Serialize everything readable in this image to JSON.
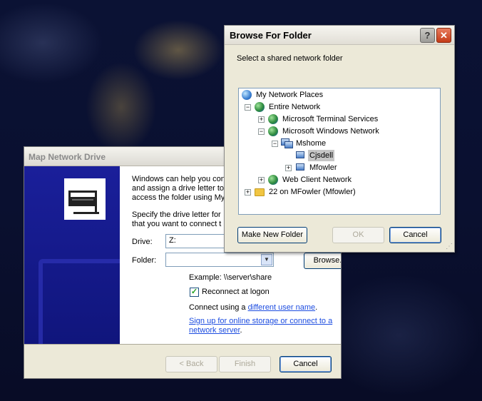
{
  "map_network_drive": {
    "title": "Map Network Drive",
    "intro_lines": [
      "Windows can help you conn",
      "and assign a drive letter to",
      "access the folder using My"
    ],
    "specify_lines": [
      "Specify the drive letter for",
      "that you want to connect t"
    ],
    "drive_label": "Drive:",
    "drive_value": "Z:",
    "folder_label": "Folder:",
    "folder_value": "",
    "browse_label": "Browse...",
    "example_text": "Example: \\\\server\\share",
    "reconnect_label": "Reconnect at logon",
    "reconnect_checked": true,
    "connect_prefix": "Connect using a ",
    "connect_link": "different user name",
    "connect_suffix": ".",
    "signup_line1": "Sign up for online storage or connect to a",
    "signup_line2": "network server",
    "signup_suffix": ".",
    "back_label": "< Back",
    "finish_label": "Finish",
    "cancel_label": "Cancel"
  },
  "browse_for_folder": {
    "title": "Browse For Folder",
    "help_glyph": "?",
    "close_glyph": "✕",
    "prompt": "Select a shared network folder",
    "tree": [
      {
        "label": "My Network Places",
        "icon": "network-places-icon",
        "expander": ""
      },
      {
        "label": "Entire Network",
        "icon": "globe-icon",
        "expander": "−"
      },
      {
        "label": "Microsoft Terminal Services",
        "icon": "globe-icon",
        "expander": "+"
      },
      {
        "label": "Microsoft Windows Network",
        "icon": "globe-icon",
        "expander": "−"
      },
      {
        "label": "Mshome",
        "icon": "workgroup-icon",
        "expander": "−"
      },
      {
        "label": "Cjsdell",
        "icon": "computer-icon",
        "expander": "",
        "selected": true
      },
      {
        "label": "Mfowler",
        "icon": "computer-icon",
        "expander": "+"
      },
      {
        "label": "Web Client Network",
        "icon": "globe-icon",
        "expander": "+"
      },
      {
        "label": "22 on MFowler (Mfowler)",
        "icon": "folder-icon",
        "expander": "+"
      }
    ],
    "make_new_folder_label": "Make New Folder",
    "ok_label": "OK",
    "cancel_label": "Cancel"
  }
}
